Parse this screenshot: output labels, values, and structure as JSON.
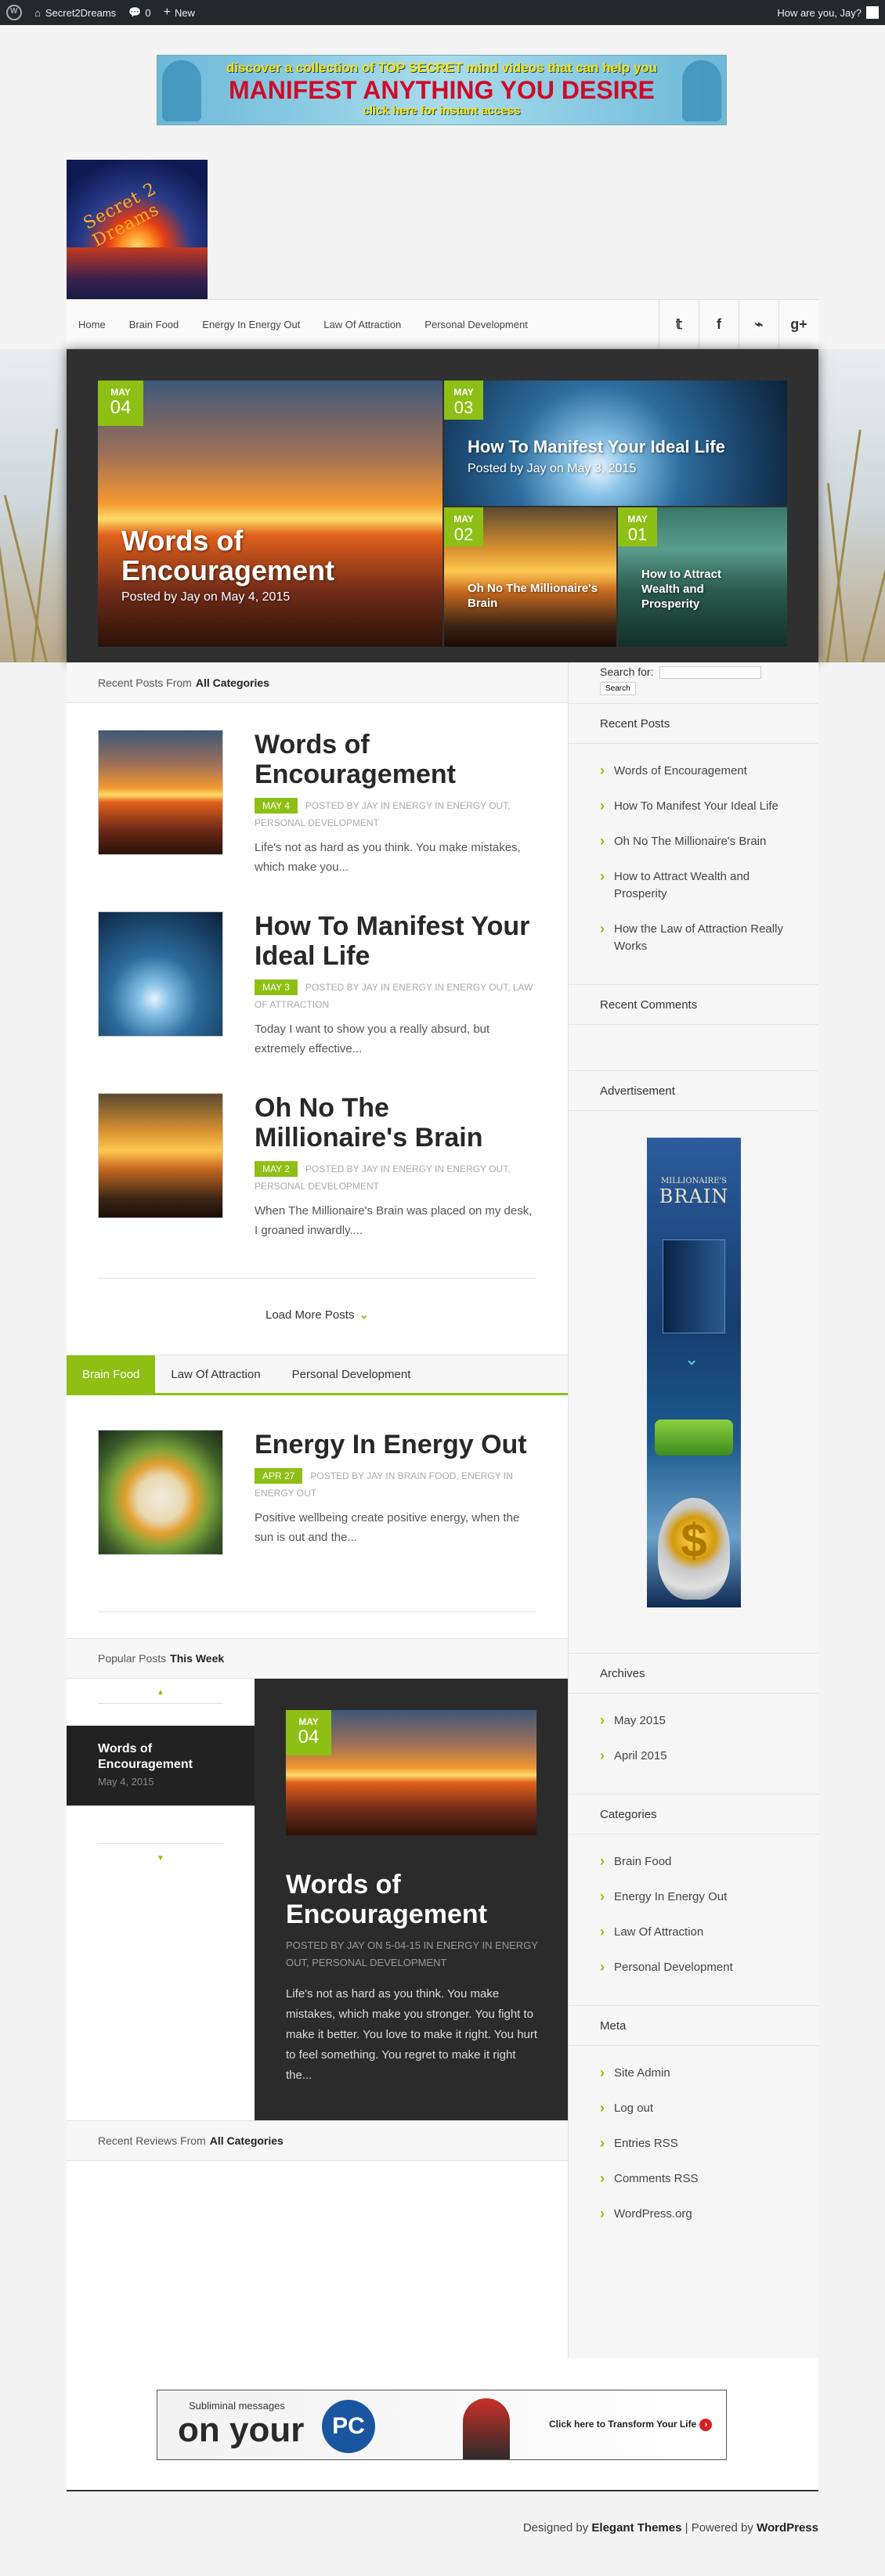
{
  "adminbar": {
    "site": "Secret2Dreams",
    "comments": "0",
    "new": "New",
    "greeting": "How are you, Jay?"
  },
  "top_banner": {
    "line1": "discover a collection of TOP SECRET mind videos that can help you",
    "line2": "MANIFEST ANYTHING YOU DESIRE",
    "line3": "click here for instant access"
  },
  "logo": {
    "text": "Secret 2 Dreams"
  },
  "nav": {
    "items": [
      "Home",
      "Brain Food",
      "Energy In Energy Out",
      "Law Of Attraction",
      "Personal Development"
    ],
    "social": [
      "twitter-icon",
      "facebook-icon",
      "rss-icon",
      "google-plus-icon"
    ],
    "social_glyphs": [
      "𝕥",
      "f",
      "⌁",
      "g+"
    ]
  },
  "featured": {
    "main": {
      "month": "MAY",
      "day": "04",
      "title": "Words of Encouragement",
      "meta": "Posted by Jay on May 4, 2015"
    },
    "top_right": {
      "month": "MAY",
      "day": "03",
      "title": "How To Manifest Your Ideal Life",
      "meta": "Posted by Jay on May 3, 2015"
    },
    "bottom_left": {
      "month": "MAY",
      "day": "02",
      "title": "Oh No The Millionaire's Brain"
    },
    "bottom_right": {
      "month": "MAY",
      "day": "01",
      "title": "How to Attract Wealth and Prosperity"
    }
  },
  "recent": {
    "heading_prefix": "Recent Posts From",
    "heading_bold": "All Categories",
    "posts": [
      {
        "title": "Words of Encouragement",
        "date": "MAY 4",
        "meta": "POSTED BY JAY IN ENERGY IN ENERGY OUT, PERSONAL DEVELOPMENT",
        "excerpt": "Life's not as hard as you think. You make mistakes, which make you..."
      },
      {
        "title": "How To Manifest Your Ideal Life",
        "date": "MAY 3",
        "meta": "POSTED BY JAY IN ENERGY IN ENERGY OUT, LAW OF ATTRACTION",
        "excerpt": "Today I want to show you a really absurd, but extremely effective..."
      },
      {
        "title": "Oh No The Millionaire's Brain",
        "date": "MAY 2",
        "meta": "POSTED BY JAY IN ENERGY IN ENERGY OUT, PERSONAL DEVELOPMENT",
        "excerpt": "When The Millionaire's Brain was placed on my desk, I groaned inwardly...."
      }
    ],
    "load_more": "Load More Posts"
  },
  "category_tabs": {
    "tabs": [
      "Brain Food",
      "Law Of Attraction",
      "Personal Development"
    ],
    "post": {
      "title": "Energy In Energy Out",
      "date": "APR 27",
      "meta": "POSTED BY JAY IN BRAIN FOOD, ENERGY IN ENERGY OUT",
      "excerpt": "Positive wellbeing create positive energy, when the sun is out and the..."
    }
  },
  "popular": {
    "heading_prefix": "Popular Posts",
    "heading_bold": "This Week",
    "list_item": {
      "title": "Words of Encouragement",
      "date": "May 4, 2015"
    },
    "feature": {
      "month": "MAY",
      "day": "04",
      "title": "Words of Encouragement",
      "meta": "POSTED BY JAY ON 5-04-15 IN ENERGY IN ENERGY OUT, PERSONAL DEVELOPMENT",
      "excerpt": "Life's not as hard as you think. You make mistakes, which make you stronger. You fight to make it better. You love to make it right. You hurt to feel something. You regret to make it right the..."
    }
  },
  "reviews": {
    "heading_prefix": "Recent Reviews From",
    "heading_bold": "All Categories"
  },
  "sidebar": {
    "search_label": "Search for:",
    "search_value": "",
    "search_button": "Search",
    "recent_posts_title": "Recent Posts",
    "recent_posts": [
      "Words of Encouragement",
      "How To Manifest Your Ideal Life",
      "Oh No The Millionaire's Brain",
      "How to Attract Wealth and Prosperity",
      "How the Law of Attraction Really Works"
    ],
    "recent_comments_title": "Recent Comments",
    "advertisement_title": "Advertisement",
    "ad": {
      "brand_small": "MILLIONAIRE'S",
      "brand_big": "BRAIN",
      "symbol": "$"
    },
    "archives_title": "Archives",
    "archives": [
      "May 2015",
      "April 2015"
    ],
    "categories_title": "Categories",
    "categories": [
      "Brain Food",
      "Energy In Energy Out",
      "Law Of Attraction",
      "Personal Development"
    ],
    "meta_title": "Meta",
    "meta": [
      "Site Admin",
      "Log out",
      "Entries RSS",
      "Comments RSS",
      "WordPress.org"
    ]
  },
  "bottom_banner": {
    "sub": "Subliminal messages",
    "big": "on your",
    "pc": "PC",
    "cta": "Click here to Transform Your Life",
    "cta_arrow": "›"
  },
  "footer": {
    "designed_by": "Designed by",
    "designer": "Elegant Themes",
    "powered_by": "| Powered by",
    "platform": "WordPress"
  }
}
